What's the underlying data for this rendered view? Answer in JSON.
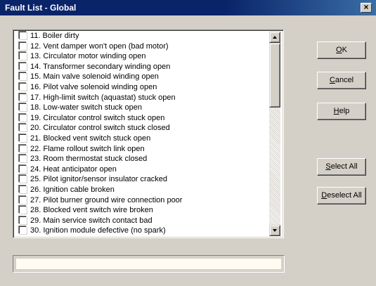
{
  "window": {
    "title": "Fault List - Global",
    "close_glyph": "×"
  },
  "faults": [
    {
      "label": "11.  Boiler dirty",
      "checked": false
    },
    {
      "label": "12.  Vent damper won't open (bad motor)",
      "checked": false
    },
    {
      "label": "13.  Circulator motor winding open",
      "checked": false
    },
    {
      "label": "14.  Transformer secondary winding open",
      "checked": false
    },
    {
      "label": "15.  Main valve solenoid winding open",
      "checked": false
    },
    {
      "label": "16.  Pilot valve solenoid winding open",
      "checked": false
    },
    {
      "label": "17.  High-limit switch (aquastat) stuck open",
      "checked": false
    },
    {
      "label": "18.  Low-water switch stuck open",
      "checked": false
    },
    {
      "label": "19.  Circulator control switch stuck open",
      "checked": false
    },
    {
      "label": "20.  Circulator control switch stuck closed",
      "checked": false
    },
    {
      "label": "21.  Blocked vent switch stuck open",
      "checked": false
    },
    {
      "label": "22.  Flame rollout switch link open",
      "checked": false
    },
    {
      "label": "23.  Room thermostat stuck closed",
      "checked": false
    },
    {
      "label": "24.  Heat anticipator open",
      "checked": false
    },
    {
      "label": "25.  Pilot ignitor/sensor insulator cracked",
      "checked": false
    },
    {
      "label": "26.  Ignition cable broken",
      "checked": false
    },
    {
      "label": "27.  Pilot burner ground wire connection poor",
      "checked": false
    },
    {
      "label": "28.  Blocked vent switch wire broken",
      "checked": false
    },
    {
      "label": "29.  Main service switch contact bad",
      "checked": false
    },
    {
      "label": "30.  Ignition module defective (no spark)",
      "checked": false
    }
  ],
  "buttons": {
    "ok": {
      "mnemonic": "O",
      "rest": "K"
    },
    "cancel": {
      "mnemonic": "C",
      "rest": "ancel"
    },
    "help": {
      "mnemonic": "H",
      "rest": "elp"
    },
    "select_all": {
      "mnemonic": "S",
      "rest": "elect All"
    },
    "deselect_all": {
      "mnemonic": "D",
      "rest": "eselect All"
    }
  },
  "status": {
    "text": ""
  },
  "colors": {
    "titlebar": "#0a246a",
    "dialog": "#d4d0c8",
    "list_background": "#ffffff",
    "status_background": "#fffbf0"
  }
}
